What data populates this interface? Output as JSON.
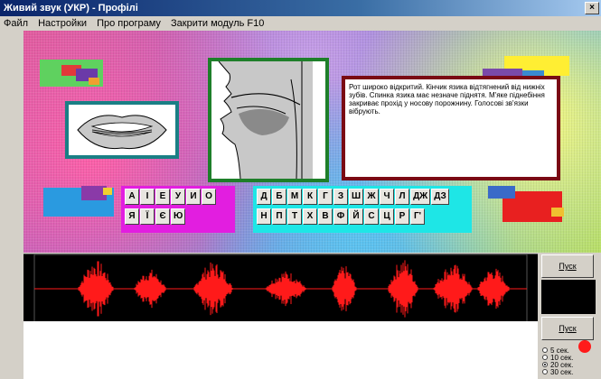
{
  "window": {
    "title": "Живий звук (УКР) - Профілі",
    "close_glyph": "×"
  },
  "menu": {
    "items": [
      "Файл",
      "Настройки",
      "Про програму",
      "Закрити модуль F10"
    ]
  },
  "articulation": {
    "description": "Рот широко відкритий. Кінчик язика відтягнений від нижніх зубів. Спинка язика має незначе піднятя. М'яке піднебіння закриває прохід у носову порожнину. Голосові зв'язки вібрують."
  },
  "keyboard": {
    "vowels": [
      [
        "А",
        "І",
        "Е",
        "У",
        "И",
        "О"
      ],
      [
        "Я",
        "Ї",
        "Є",
        "Ю"
      ]
    ],
    "consonants": [
      [
        "Д",
        "Б",
        "М",
        "К",
        "Г",
        "З",
        "Ш",
        "Ж",
        "Ч",
        "Л",
        "ДЖ",
        "ДЗ"
      ],
      [
        "Н",
        "П",
        "Т",
        "Х",
        "В",
        "Ф",
        "Й",
        "С",
        "Ц",
        "Р",
        "Г'"
      ]
    ]
  },
  "controls": {
    "play_top_label": "Пуск",
    "play_bottom_label": "Пуск",
    "durations": [
      "5 сек.",
      "10 сек.",
      "20 сек.",
      "30 сек."
    ],
    "selected_duration_index": 2
  },
  "colors": {
    "lips_frame": "#1a7f85",
    "face_frame": "#1e7f2a",
    "desc_frame": "#7a0a14",
    "waveform": "#ff1a1a"
  }
}
